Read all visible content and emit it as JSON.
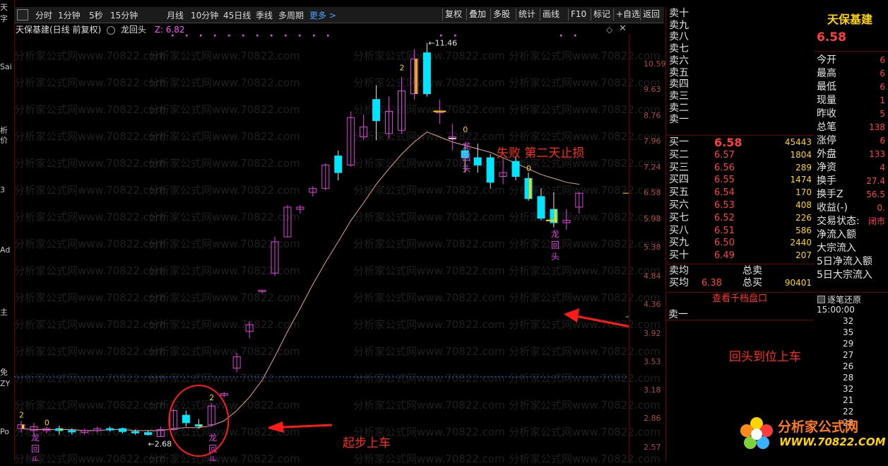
{
  "left_strip": [
    "天",
    "字",
    "Sai",
    "析",
    "价",
    "3",
    "Ad",
    "主",
    "免",
    "ZY",
    "Po"
  ],
  "toolbar": {
    "periods": [
      "分时",
      "1分钟",
      "5秒",
      "15分钟",
      "月线",
      "10分钟",
      "45日线",
      "季线",
      "多周期"
    ],
    "more": "更多 >",
    "buttons": [
      "复权",
      "叠加",
      "多股",
      "统计",
      "画线",
      "F10",
      "标记",
      "+自选",
      "返回"
    ]
  },
  "chart_header": {
    "stock": "天保基建(日线 前复权)",
    "indicator": "龙回头",
    "z_label": "Z: 6.82"
  },
  "watermark": "分析家公式网www.70822.com",
  "price_axis": [
    "10.59",
    "9.63",
    "8.76",
    "7.96",
    "7.24",
    "6.58",
    "5.98",
    "5.38",
    "4.84",
    "4.36",
    "3.92",
    "3.53",
    "3.18",
    "2.86",
    "2.57"
  ],
  "chart_data": {
    "type": "candlestick",
    "ylim": [
      2.5,
      11.6
    ],
    "scale": "log",
    "candles": [
      [
        2.76,
        2.8,
        2.72,
        2.84
      ],
      [
        2.74,
        2.78,
        2.7,
        2.82
      ],
      [
        2.74,
        2.76,
        2.71,
        2.78
      ],
      [
        2.76,
        2.74,
        2.7,
        2.79
      ],
      [
        2.74,
        2.73,
        2.7,
        2.76
      ],
      [
        2.72,
        2.74,
        2.7,
        2.76
      ],
      [
        2.74,
        2.76,
        2.72,
        2.78
      ],
      [
        2.76,
        2.75,
        2.73,
        2.78
      ],
      [
        2.76,
        2.73,
        2.71,
        2.77
      ],
      [
        2.73,
        2.72,
        2.7,
        2.75
      ],
      [
        2.72,
        2.7,
        2.69,
        2.74
      ],
      [
        2.68,
        2.75,
        2.68,
        2.78
      ],
      [
        2.75,
        2.95,
        2.74,
        2.97
      ],
      [
        2.9,
        2.82,
        2.78,
        2.95
      ],
      [
        2.8,
        2.79,
        2.76,
        2.86
      ],
      [
        2.8,
        3.0,
        2.78,
        3.03
      ],
      [
        3.12,
        3.14,
        3.1,
        3.16
      ],
      [
        3.45,
        3.6,
        3.4,
        3.65
      ],
      [
        3.95,
        4.05,
        3.85,
        4.1
      ],
      [
        4.6,
        4.6,
        4.55,
        4.6
      ],
      [
        4.9,
        5.5,
        4.85,
        5.6
      ],
      [
        5.6,
        6.25,
        5.6,
        6.3
      ],
      [
        6.2,
        6.25,
        6.1,
        6.3
      ],
      [
        6.6,
        6.7,
        6.5,
        6.75
      ],
      [
        6.7,
        7.3,
        6.65,
        7.35
      ],
      [
        7.55,
        7.1,
        6.9,
        7.7
      ],
      [
        7.3,
        8.7,
        7.25,
        8.9
      ],
      [
        8.1,
        8.4,
        8.0,
        8.8
      ],
      [
        9.3,
        8.6,
        8.0,
        9.8
      ],
      [
        8.2,
        8.9,
        8.05,
        9.4
      ],
      [
        8.3,
        9.6,
        8.2,
        10.1
      ],
      [
        9.5,
        10.8,
        9.3,
        11.2
      ],
      [
        11.05,
        9.5,
        9.4,
        11.46
      ],
      [
        8.9,
        8.9,
        8.5,
        9.3
      ],
      [
        8.1,
        8.1,
        7.7,
        8.5
      ],
      [
        7.7,
        7.5,
        7.1,
        7.9
      ],
      [
        7.5,
        7.3,
        7.1,
        7.9
      ],
      [
        7.5,
        6.85,
        6.7,
        7.6
      ],
      [
        7.0,
        7.1,
        6.8,
        7.5
      ],
      [
        7.4,
        7.0,
        6.9,
        7.55
      ],
      [
        6.95,
        6.45,
        6.4,
        7.1
      ],
      [
        6.5,
        6.0,
        5.95,
        6.7
      ],
      [
        6.2,
        5.9,
        5.8,
        6.6
      ],
      [
        5.9,
        5.95,
        5.75,
        6.2
      ],
      [
        6.25,
        6.58,
        6.1,
        6.6
      ]
    ],
    "ma": [
      2.76,
      2.75,
      2.75,
      2.75,
      2.75,
      2.74,
      2.74,
      2.75,
      2.75,
      2.74,
      2.74,
      2.74,
      2.76,
      2.77,
      2.77,
      2.79,
      2.84,
      2.95,
      3.1,
      3.3,
      3.6,
      3.95,
      4.3,
      4.7,
      5.1,
      5.5,
      5.95,
      6.35,
      6.8,
      7.2,
      7.6,
      7.95,
      8.25,
      8.1,
      7.95,
      7.85,
      7.75,
      7.65,
      7.5,
      7.35,
      7.2,
      7.05,
      6.95,
      6.85,
      6.8
    ],
    "annotations": {
      "high_label": "11.46",
      "low_label": "2.68",
      "signal_twos": [
        "2",
        "2",
        "2"
      ],
      "signal_zeros": [
        "0",
        "0",
        "0"
      ],
      "dragon_label": "龙回头"
    },
    "dots_row_count": 16
  },
  "notes": {
    "fail": "失败 第二天止损",
    "return": "回头到位上车",
    "start": "起步上车"
  },
  "quote": {
    "sells": [
      "卖十",
      "卖九",
      "卖八",
      "卖七",
      "卖六",
      "卖五",
      "卖四",
      "卖三",
      "卖二",
      "卖一"
    ],
    "buys": [
      {
        "label": "买一",
        "price": "6.58",
        "vol": "45443"
      },
      {
        "label": "买二",
        "price": "6.57",
        "vol": "1804"
      },
      {
        "label": "买三",
        "price": "6.56",
        "vol": "289"
      },
      {
        "label": "买四",
        "price": "6.55",
        "vol": "1474"
      },
      {
        "label": "买五",
        "price": "6.54",
        "vol": "170"
      },
      {
        "label": "买六",
        "price": "6.53",
        "vol": "408"
      },
      {
        "label": "买七",
        "price": "6.52",
        "vol": "226"
      },
      {
        "label": "买八",
        "price": "6.51",
        "vol": "586"
      },
      {
        "label": "买九",
        "price": "6.50",
        "vol": "2440"
      },
      {
        "label": "买十",
        "price": "6.49",
        "vol": "207"
      }
    ],
    "sell_avg": "卖均",
    "buy_avg": "买均",
    "buy_avg_price": "6.38",
    "total_sell": "总卖",
    "total_buy": "总买",
    "total_buy_vol": "90401",
    "view_ten": "查看千档盘口",
    "sell_one": "卖一"
  },
  "stock_panel": {
    "name": "天保基建",
    "price": "6.58",
    "rows": [
      {
        "label": "今开",
        "val": "6"
      },
      {
        "label": "最高",
        "val": "6"
      },
      {
        "label": "最低",
        "val": "6"
      },
      {
        "label": "现量",
        "val": "1"
      },
      {
        "label": "昨收",
        "val": "5"
      },
      {
        "label": "总笔",
        "val": "138"
      },
      {
        "label": "涨停",
        "val": "6"
      },
      {
        "label": "外盘",
        "val": "133"
      },
      {
        "label": "净资",
        "val": "4"
      },
      {
        "label": "换手",
        "val": "27.4"
      },
      {
        "label": "换手Z",
        "val": "56.5"
      },
      {
        "label": "收益(-)",
        "val": "0."
      },
      {
        "label": "交易状态:",
        "val": "闭市"
      },
      {
        "label": "净流入额",
        "val": ""
      },
      {
        "label": "大宗流入",
        "val": ""
      },
      {
        "label": "5日净流入额",
        "val": ""
      },
      {
        "label": "5日大宗流入",
        "val": ""
      }
    ]
  },
  "ticks": {
    "title": "逐笔还原",
    "time": "15:00:00",
    "vals": [
      "32",
      "35",
      "29",
      "27",
      "26",
      "28",
      "32",
      "21",
      "22",
      "28"
    ]
  },
  "logo": {
    "title": "分析家公式网",
    "url": "WWW.70822.COM"
  }
}
